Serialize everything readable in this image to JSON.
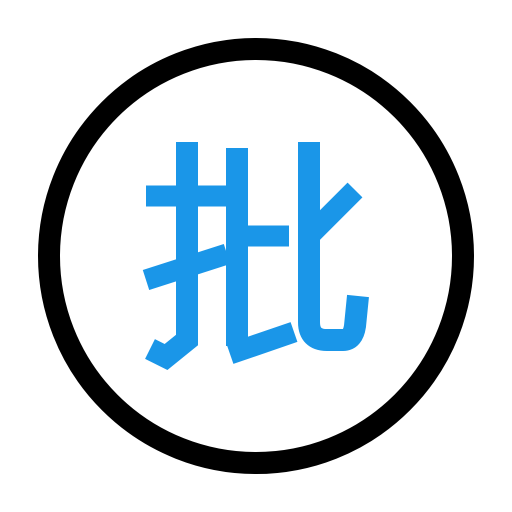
{
  "badge": {
    "character": "批",
    "character_color": "#1a96e8",
    "ring_color": "#000000",
    "background_color": "#ffffff",
    "icon": "approve-character-badge-icon"
  }
}
